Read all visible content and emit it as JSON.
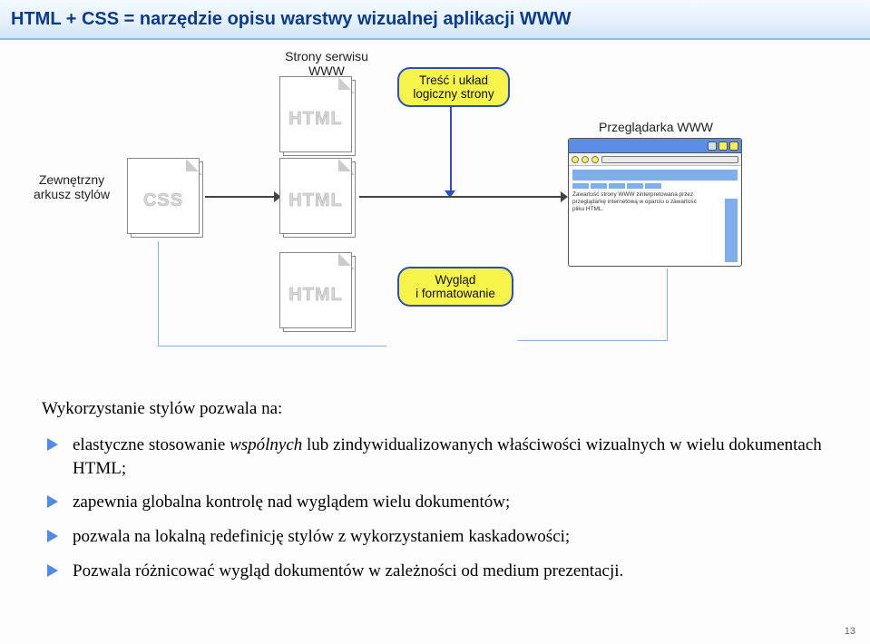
{
  "header": {
    "title": "HTML + CSS = narzędzie opisu warstwy wizualnej aplikacji WWW"
  },
  "diagram": {
    "css_label": "CSS",
    "html_label": "HTML",
    "caption_stylesheet": "Zewnętrzny\narkusz stylów",
    "caption_pages": "Strony serwisu\nWWW",
    "bubble_content": "Treść i układ\nlogiczny strony",
    "bubble_appearance": "Wygląd\ni formatowanie",
    "browser_caption": "Przeglądarka WWW",
    "browser_text": "Zawartość strony WWW zinterpretowana przez przeglądarkę internetową w oparciu o zawartość pliku HTML."
  },
  "body_text": {
    "intro": "Wykorzystanie stylów pozwala na:",
    "bullets": [
      "elastyczne stosowanie wspólnych lub zindywidualizowanych właściwości wizualnych w wielu dokumentach HTML;",
      "zapewnia globalna kontrolę nad wyglądem wielu dokumentów;",
      "pozwala na lokalną redefinicję stylów z wykorzystaniem kaskadowości;",
      "Pozwala różnicować wygląd dokumentów w zależności od medium prezentacji."
    ]
  },
  "page_number": "13"
}
